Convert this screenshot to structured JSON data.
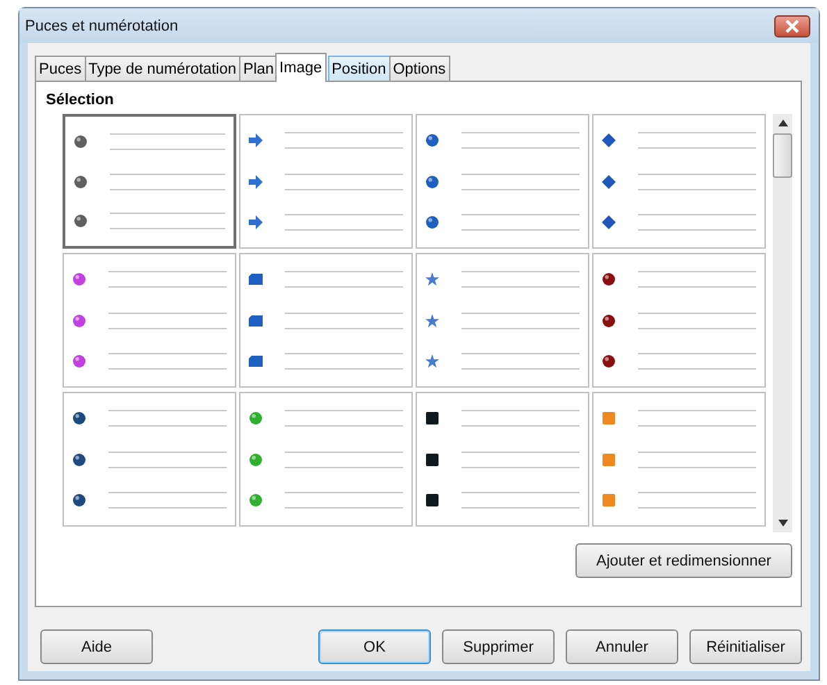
{
  "window": {
    "title": "Puces et numérotation"
  },
  "tabs": [
    {
      "label": "Puces",
      "selected": false,
      "hovered": false
    },
    {
      "label": "Type de numérotation",
      "selected": false,
      "hovered": false
    },
    {
      "label": "Plan",
      "selected": false,
      "hovered": false
    },
    {
      "label": "Image",
      "selected": true,
      "hovered": false
    },
    {
      "label": "Position",
      "selected": false,
      "hovered": true
    },
    {
      "label": "Options",
      "selected": false,
      "hovered": false
    }
  ],
  "section_title": "Sélection",
  "gallery": [
    {
      "kind": "ball",
      "color": "#606060",
      "selected": true
    },
    {
      "kind": "arrow",
      "color": "#2f6fd0",
      "selected": false
    },
    {
      "kind": "ball",
      "color": "#1f5fc0",
      "selected": false
    },
    {
      "kind": "diamond",
      "color": "#1f58b8",
      "selected": false
    },
    {
      "kind": "ball",
      "color": "#c040e0",
      "selected": false
    },
    {
      "kind": "cube",
      "color": "#1f5fc0",
      "selected": false
    },
    {
      "kind": "star",
      "color": "#4a7ad0",
      "selected": false
    },
    {
      "kind": "ball",
      "color": "#8a1010",
      "selected": false
    },
    {
      "kind": "ball",
      "color": "#1e4a80",
      "selected": false
    },
    {
      "kind": "ball",
      "color": "#30b030",
      "selected": false
    },
    {
      "kind": "square",
      "color": "#101820",
      "selected": false
    },
    {
      "kind": "square",
      "color": "#f08820",
      "selected": false
    }
  ],
  "add_button": "Ajouter et redimensionner",
  "buttons": [
    {
      "label": "Aide",
      "default": false
    },
    {
      "label": "OK",
      "default": true
    },
    {
      "label": "Supprimer",
      "default": false
    },
    {
      "label": "Annuler",
      "default": false
    },
    {
      "label": "Réinitialiser",
      "default": false
    }
  ]
}
